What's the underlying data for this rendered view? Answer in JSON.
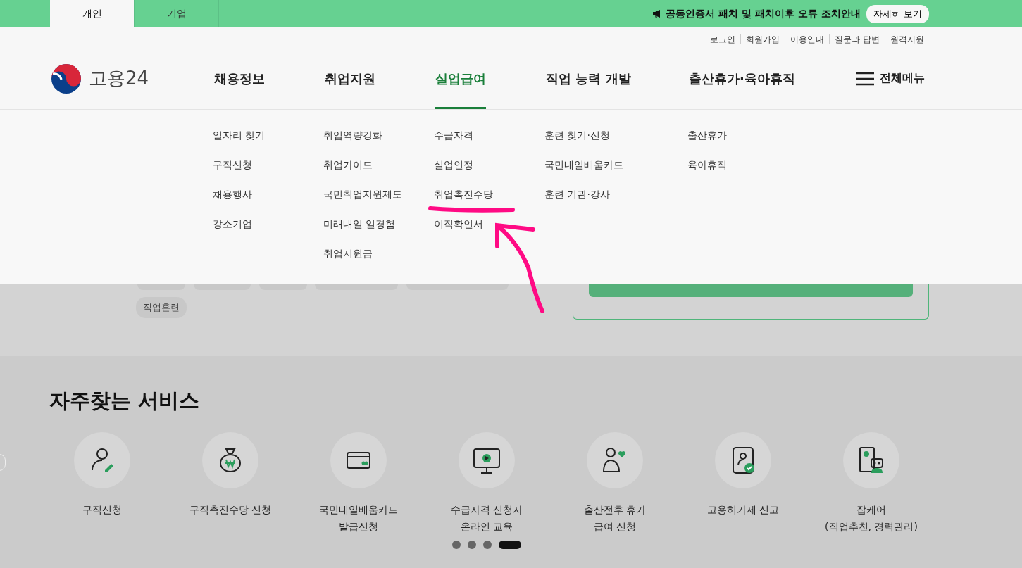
{
  "audience_tabs": [
    {
      "label": "개인",
      "selected": true
    },
    {
      "label": "기업",
      "selected": false
    }
  ],
  "notice": {
    "text": "공동인증서 패치 및 패치이후 오류 조치안내",
    "button": "자세히 보기"
  },
  "util_links": [
    "로그인",
    "회원가입",
    "이용안내",
    "질문과 답변",
    "원격지원"
  ],
  "logo": {
    "text": "고용24"
  },
  "nav": [
    {
      "label": "채용정보",
      "selected": false,
      "items": [
        "일자리 찾기",
        "구직신청",
        "채용행사",
        "강소기업"
      ]
    },
    {
      "label": "취업지원",
      "selected": false,
      "items": [
        "취업역량강화",
        "취업가이드",
        "국민취업지원제도",
        "미래내일 일경험",
        "취업지원금"
      ]
    },
    {
      "label": "실업급여",
      "selected": true,
      "items": [
        "수급자격",
        "실업인정",
        "취업촉진수당",
        "이직확인서"
      ]
    },
    {
      "label": "직업 능력 개발",
      "selected": false,
      "items": [
        "훈련 찾기·신청",
        "국민내일배움카드",
        "훈련 기관·강사"
      ]
    },
    {
      "label": "출산휴가·육아휴직",
      "selected": false,
      "items": [
        "출산휴가",
        "육아휴직"
      ]
    }
  ],
  "all_menu": "전체메뉴",
  "tag": "직업훈련",
  "services": {
    "title": "자주찾는 서비스",
    "items": [
      {
        "label": [
          "구직신청"
        ]
      },
      {
        "label": [
          "구직촉진수당 신청"
        ]
      },
      {
        "label": [
          "국민내일배움카드",
          "발급신청"
        ]
      },
      {
        "label": [
          "수급자격 신청자",
          "온라인 교육"
        ]
      },
      {
        "label": [
          "출산전후 휴가",
          "급여 신청"
        ]
      },
      {
        "label": [
          "고용허가제 신고"
        ]
      },
      {
        "label": [
          "잡케어",
          "(직업추천, 경력관리)"
        ]
      }
    ]
  },
  "pagination": [
    {
      "selected": false
    },
    {
      "selected": false
    },
    {
      "selected": false
    },
    {
      "selected": true
    }
  ]
}
